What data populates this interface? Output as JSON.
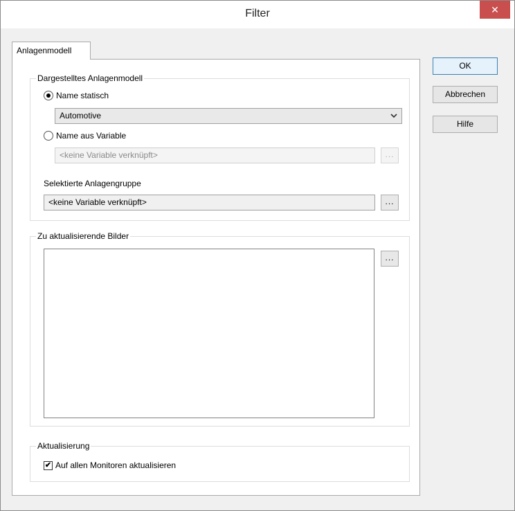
{
  "window": {
    "title": "Filter",
    "close_glyph": "✕"
  },
  "tabs": [
    {
      "label": "Anlagenmodell"
    }
  ],
  "plant_model": {
    "group_label": "Dargestelltes Anlagenmodell",
    "radio_static_label": "Name statisch",
    "radio_static_checked": true,
    "static_select_value": "Automotive",
    "radio_variable_label": "Name aus Variable",
    "radio_variable_checked": false,
    "variable_field_value": "<keine Variable verknüpft>",
    "variable_button_label": "...",
    "selected_group_label": "Selektierte Anlagengruppe",
    "selected_group_value": "<keine Variable verknüpft>",
    "selected_group_button_label": "..."
  },
  "pictures": {
    "group_label": "Zu aktualisierende Bilder",
    "button_label": "...",
    "items": []
  },
  "update": {
    "group_label": "Aktualisierung",
    "checkbox_label": "Auf allen Monitoren aktualisieren",
    "checkbox_checked": true,
    "check_glyph": "✔"
  },
  "buttons": {
    "ok": "OK",
    "cancel": "Abbrechen",
    "help": "Hilfe"
  },
  "icons": {
    "dropdown": "chevron-down-icon",
    "close": "close-icon"
  }
}
